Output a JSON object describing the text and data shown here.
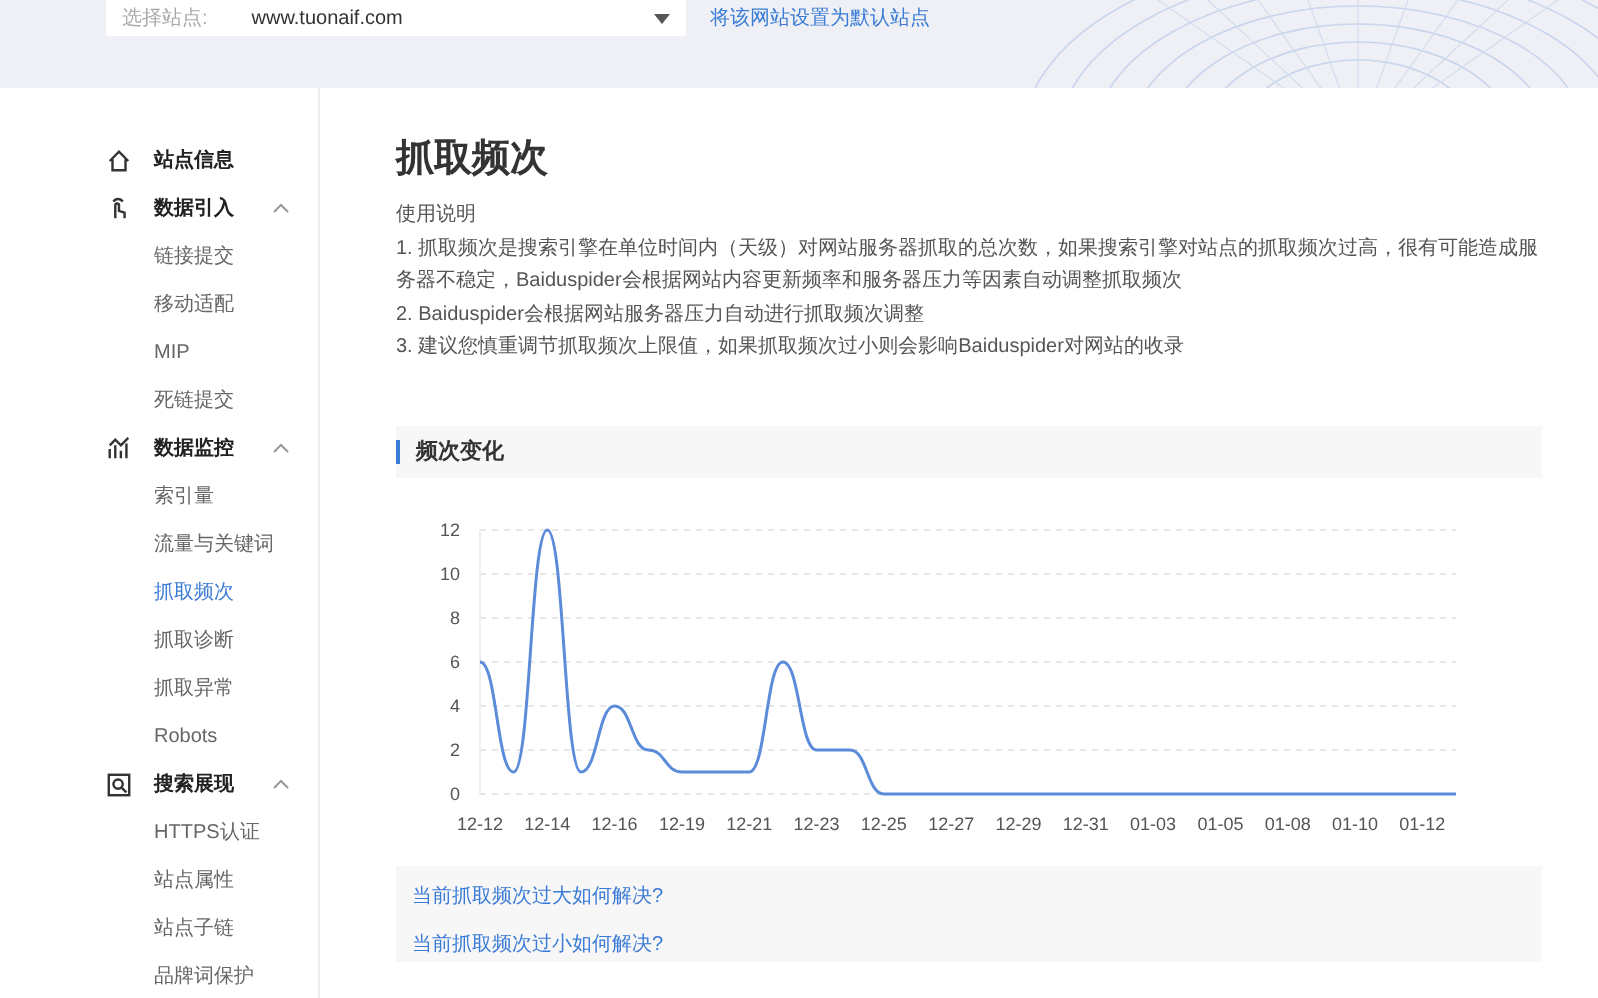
{
  "header": {
    "site_label": "选择站点:",
    "site_value": "www.tuonaif.com",
    "default_link": "将该网站设置为默认站点"
  },
  "sidebar": [
    {
      "kind": "link",
      "label": "站点信息"
    },
    {
      "kind": "group",
      "label": "数据引入",
      "expanded": true,
      "children": [
        {
          "label": "链接提交",
          "selected": false
        },
        {
          "label": "移动适配",
          "selected": false
        },
        {
          "label": "MIP",
          "selected": false
        },
        {
          "label": "死链提交",
          "selected": false
        }
      ]
    },
    {
      "kind": "group",
      "label": "数据监控",
      "expanded": true,
      "children": [
        {
          "label": "索引量",
          "selected": false
        },
        {
          "label": "流量与关键词",
          "selected": false
        },
        {
          "label": "抓取频次",
          "selected": true
        },
        {
          "label": "抓取诊断",
          "selected": false
        },
        {
          "label": "抓取异常",
          "selected": false
        },
        {
          "label": "Robots",
          "selected": false
        }
      ]
    },
    {
      "kind": "group",
      "label": "搜索展现",
      "expanded": true,
      "children": [
        {
          "label": "HTTPS认证",
          "selected": false
        },
        {
          "label": "站点属性",
          "selected": false
        },
        {
          "label": "站点子链",
          "selected": false
        },
        {
          "label": "品牌词保护",
          "selected": false
        }
      ]
    }
  ],
  "page_title": "抓取频次",
  "instructions": {
    "heading": "使用说明",
    "items": [
      "1. 抓取频次是搜索引擎在单位时间内（天级）对网站服务器抓取的总次数，如果搜索引擎对站点的抓取频次过高，很有可能造成服务器不稳定，Baiduspider会根据网站内容更新频率和服务器压力等因素自动调整抓取频次",
      "2. Baiduspider会根据网站服务器压力自动进行抓取频次调整",
      "3. 建议您慎重调节抓取频次上限值，如果抓取频次过小则会影响Baiduspider对网站的收录"
    ]
  },
  "section": {
    "title": "频次变化",
    "chart_data": {
      "type": "line",
      "categories": [
        "12-12",
        null,
        "12-14",
        null,
        "12-16",
        null,
        "12-19",
        null,
        "12-21",
        null,
        "12-23",
        null,
        "12-25",
        null,
        "12-27",
        null,
        "12-29",
        null,
        "12-31",
        null,
        "01-03",
        null,
        "01-05",
        null,
        "01-08",
        null,
        "01-10",
        null,
        "01-12",
        null
      ],
      "series": [
        {
          "color": "#5b8bd9",
          "values": [
            6,
            1,
            12,
            1,
            4,
            2,
            1,
            1,
            1,
            6,
            2,
            2,
            0,
            0,
            0,
            0,
            0,
            0,
            0,
            0,
            0,
            0,
            0,
            0,
            0,
            0,
            0,
            0,
            0,
            0
          ]
        }
      ],
      "ylim": [
        0,
        12
      ],
      "yticks": [
        0,
        2,
        4,
        6,
        8,
        10,
        12
      ],
      "grid": true
    }
  },
  "help_links": [
    "当前抓取频次过大如何解决?",
    "当前抓取频次过小如何解决?"
  ]
}
